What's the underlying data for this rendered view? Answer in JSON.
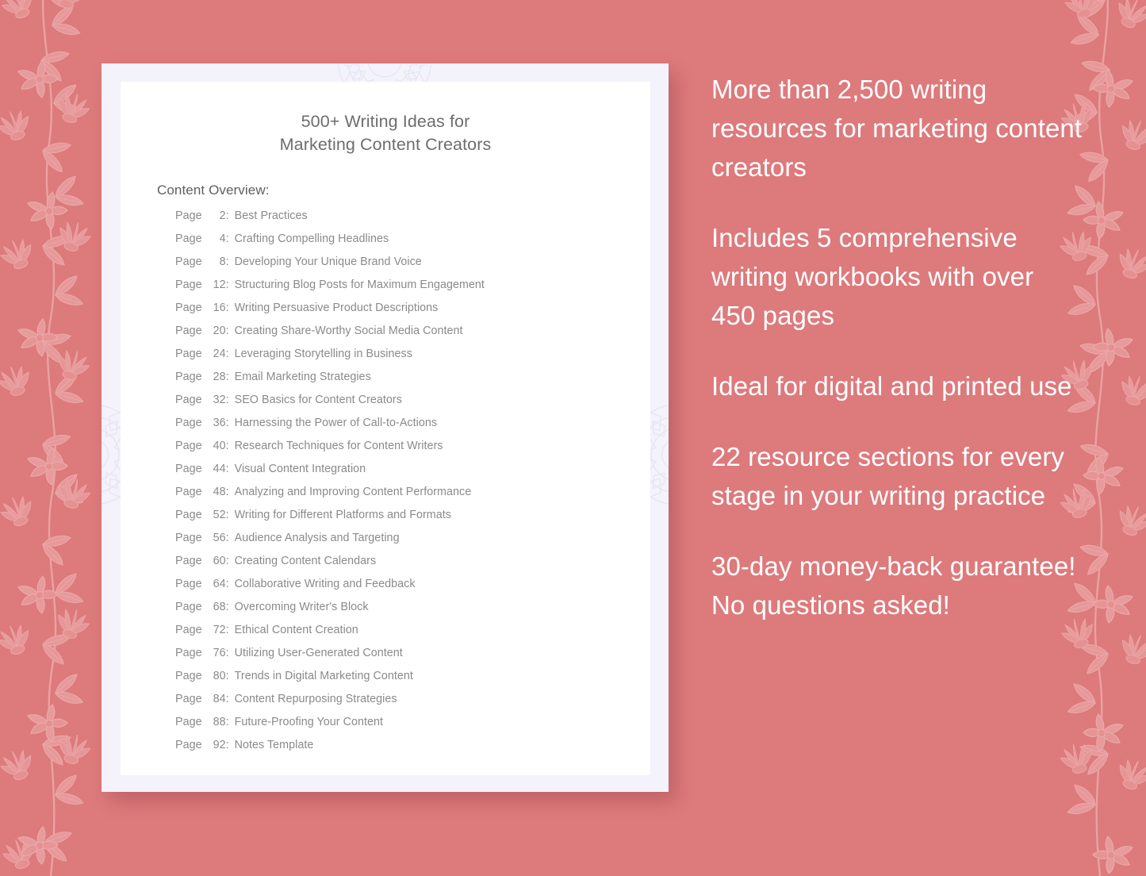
{
  "theme": {
    "background_color": "#dd7a7c",
    "card_border_color": "#f4f2fb",
    "page_color": "#ffffff",
    "title_color": "#6d6d6d",
    "toc_text_color": "#8a8a8a",
    "promo_text_color": "#ffffff"
  },
  "document": {
    "title_line_1": "500+ Writing Ideas for",
    "title_line_2": "Marketing Content Creators",
    "overview_label": "Content Overview:",
    "page_word": "Page",
    "colon": ":",
    "toc": [
      {
        "page": "2",
        "title": "Best Practices"
      },
      {
        "page": "4",
        "title": "Crafting Compelling Headlines"
      },
      {
        "page": "8",
        "title": "Developing Your Unique Brand Voice"
      },
      {
        "page": "12",
        "title": "Structuring Blog Posts for Maximum Engagement"
      },
      {
        "page": "16",
        "title": "Writing Persuasive Product Descriptions"
      },
      {
        "page": "20",
        "title": "Creating Share-Worthy Social Media Content"
      },
      {
        "page": "24",
        "title": "Leveraging Storytelling in Business"
      },
      {
        "page": "28",
        "title": "Email Marketing Strategies"
      },
      {
        "page": "32",
        "title": "SEO Basics for Content Creators"
      },
      {
        "page": "36",
        "title": "Harnessing the Power of Call-to-Actions"
      },
      {
        "page": "40",
        "title": "Research Techniques for Content Writers"
      },
      {
        "page": "44",
        "title": "Visual Content Integration"
      },
      {
        "page": "48",
        "title": "Analyzing and Improving Content Performance"
      },
      {
        "page": "52",
        "title": "Writing for Different Platforms and Formats"
      },
      {
        "page": "56",
        "title": "Audience Analysis and Targeting"
      },
      {
        "page": "60",
        "title": "Creating Content Calendars"
      },
      {
        "page": "64",
        "title": "Collaborative Writing and Feedback"
      },
      {
        "page": "68",
        "title": "Overcoming Writer's Block"
      },
      {
        "page": "72",
        "title": "Ethical Content Creation"
      },
      {
        "page": "76",
        "title": "Utilizing User-Generated Content"
      },
      {
        "page": "80",
        "title": "Trends in Digital Marketing Content"
      },
      {
        "page": "84",
        "title": "Content Repurposing Strategies"
      },
      {
        "page": "88",
        "title": "Future-Proofing Your Content"
      },
      {
        "page": "92",
        "title": "Notes Template"
      }
    ]
  },
  "promo": {
    "items": [
      "More than 2,500 writing resources for marketing content creators",
      "Includes 5 comprehensive writing workbooks with over 450 pages",
      "Ideal for digital and printed use",
      "22 resource sections for every stage in your writing practice",
      "30-day money-back guarantee! No questions asked!"
    ]
  },
  "decoration": {
    "left_border": "floral-vine-pattern",
    "right_border": "floral-vine-pattern",
    "page_watermark": "mandala-watermark"
  }
}
